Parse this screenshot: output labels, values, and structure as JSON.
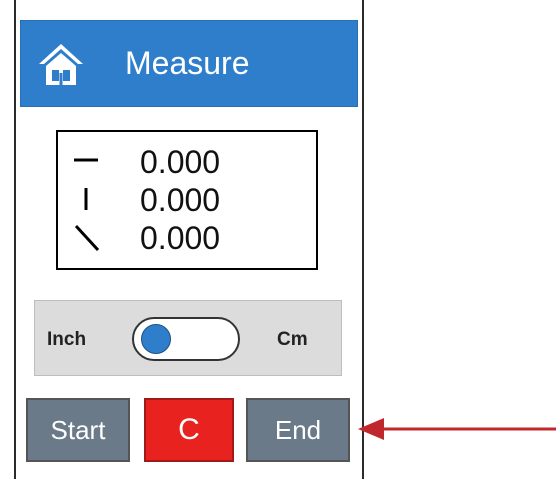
{
  "header": {
    "title": "Measure",
    "icon": "home-icon"
  },
  "display": {
    "rows": [
      {
        "icon": "horizontal-line-icon",
        "value": "0.000"
      },
      {
        "icon": "vertical-line-icon",
        "value": "0.000"
      },
      {
        "icon": "diagonal-line-icon",
        "value": "0.000"
      }
    ]
  },
  "unit_toggle": {
    "left_label": "Inch",
    "right_label": "Cm",
    "selected": "Inch"
  },
  "buttons": {
    "start": "Start",
    "clear": "C",
    "end": "End"
  },
  "colors": {
    "accent": "#2f7ecb",
    "clear": "#e8231f",
    "button_gray": "#6b7a88",
    "arrow": "#c0282d"
  }
}
